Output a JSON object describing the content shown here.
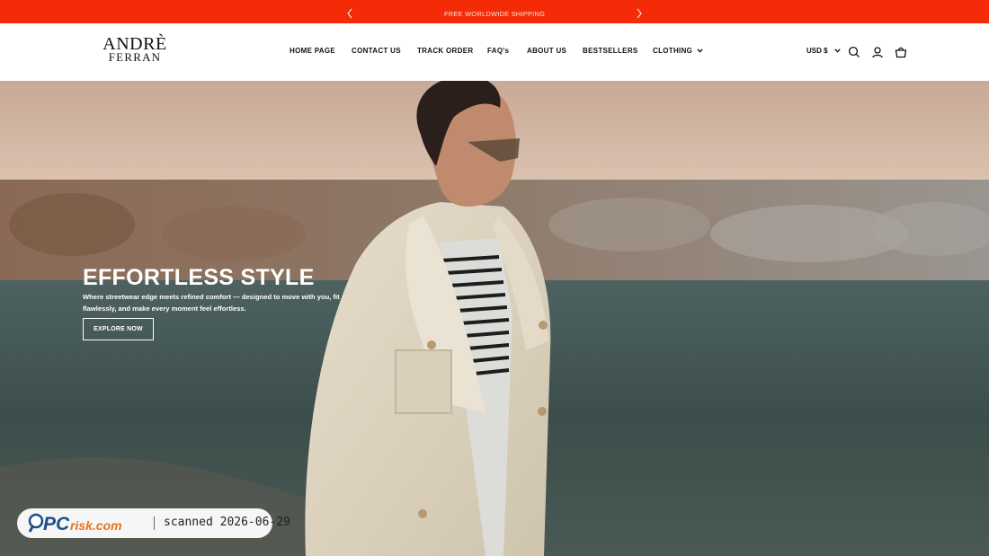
{
  "announcement": {
    "text": "FREE WORLDWIDE SHIPPING",
    "prev_icon": "chevron-left",
    "next_icon": "chevron-right",
    "color": "#f52a06"
  },
  "header": {
    "logo": {
      "line1": "ANDRÈ",
      "line2": "FERRAN"
    },
    "nav": [
      {
        "label": "HOME PAGE"
      },
      {
        "label": "CONTACT US"
      },
      {
        "label": "TRACK ORDER"
      },
      {
        "label": "FAQ's"
      },
      {
        "label": "ABOUT US"
      },
      {
        "label": "BESTSELLERS"
      },
      {
        "label": "CLOTHING",
        "icon": "chevron-down"
      }
    ],
    "currency": "USD $",
    "icons": [
      "search-icon",
      "account-icon",
      "cart-icon"
    ]
  },
  "hero": {
    "title": "EFFORTLESS STYLE",
    "subtitle": "Where streetwear edge meets refined comfort — designed to move with you, fit flawlessly, and make every moment feel effortless.",
    "button": "EXPLORE NOW"
  },
  "watermark": {
    "brand_pc": "PC",
    "brand_rest": "risk.com",
    "text": "scanned 2026-06-29"
  }
}
